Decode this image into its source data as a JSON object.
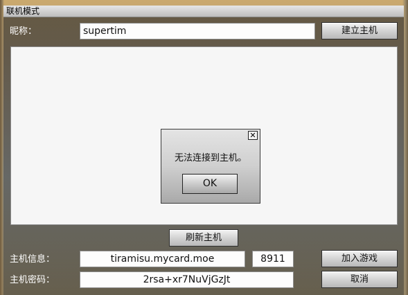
{
  "window": {
    "title": "联机模式"
  },
  "nickname": {
    "label": "昵称：",
    "value": "supertim"
  },
  "buttons": {
    "create_host": "建立主机",
    "refresh_host": "刷新主机",
    "join_game": "加入游戏",
    "cancel": "取消"
  },
  "host_info": {
    "label": "主机信息：",
    "address": "tiramisu.mycard.moe",
    "port": "8911"
  },
  "host_password": {
    "label": "主机密码：",
    "value": "2rsa+xr7NuVjGzJt"
  },
  "dialog": {
    "close_glyph": "✕",
    "message": "无法连接到主机。",
    "ok_label": "OK"
  }
}
